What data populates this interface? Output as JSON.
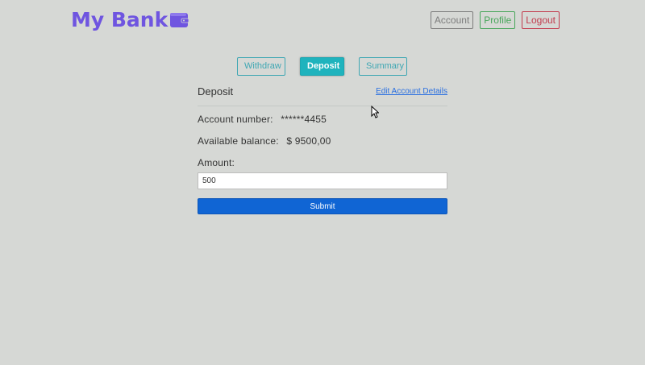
{
  "header": {
    "brand": "My Bank",
    "nav": {
      "account": "Account",
      "profile": "Profile",
      "logout": "Logout"
    }
  },
  "tabs": {
    "withdraw": "Withdraw",
    "deposit": "Deposit",
    "summary": "Summary",
    "active": "Deposit"
  },
  "panel": {
    "title": "Deposit",
    "edit_link": "Edit Account Details",
    "account_label": "Account number:",
    "account_value": "******4455",
    "balance_label": "Available balance:",
    "balance_value": "$ 9500,00",
    "amount_label": "Amount:",
    "amount_value": "500",
    "submit": "Submit"
  },
  "colors": {
    "background": "#d6d8d5",
    "brand": "#6f55e0",
    "tab_accent": "#1fb3bd",
    "submit": "#1065d4"
  }
}
